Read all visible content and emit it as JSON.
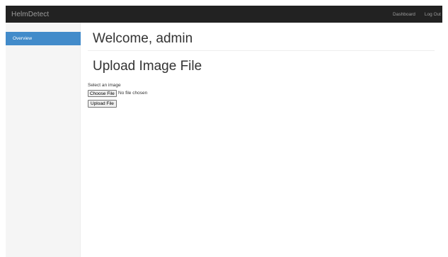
{
  "navbar": {
    "brand": "HelmDetect",
    "links": [
      "Dashboard",
      "Log Out"
    ]
  },
  "sidebar": {
    "items": [
      {
        "label": "Overview",
        "active": true
      }
    ]
  },
  "main": {
    "welcome": "Welcome, admin",
    "upload_title": "Upload Image File"
  },
  "form": {
    "label": "Select an image",
    "choose_label": "Choose File",
    "file_status": "No file chosen",
    "submit_label": "Upload File"
  },
  "colors": {
    "navbar_bg": "#222222",
    "nav_text": "#9d9d9d",
    "accent": "#428bca",
    "sidebar_bg": "#f5f5f5"
  }
}
